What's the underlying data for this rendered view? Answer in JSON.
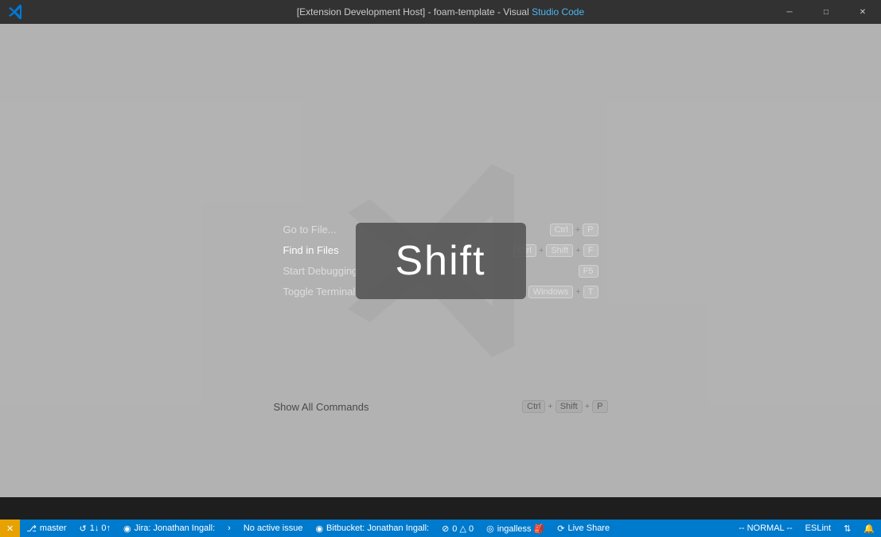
{
  "titleBar": {
    "title": "[Extension Development Host] - foam-template - Visual ",
    "titleBlue": "Studio Code",
    "minimize": "─",
    "maximize": "□",
    "close": "✕"
  },
  "mainArea": {
    "background": "#f3f3f3"
  },
  "shortcuts": [
    {
      "label": "Show All Commands",
      "keys": [
        "Ctrl",
        "+",
        "Shift",
        "+",
        "P"
      ]
    },
    {
      "label": "Go to File...",
      "keys": [
        "Ctrl",
        "+",
        "P"
      ]
    },
    {
      "label": "Find in Files",
      "keys": [
        "Ctrl",
        "+",
        "Shift",
        "+",
        "F"
      ]
    },
    {
      "label": "Start Debugging",
      "keys": [
        "F5"
      ]
    },
    {
      "label": "Toggle Terminal",
      "keys": [
        "Windows",
        "+",
        "T"
      ]
    }
  ],
  "shiftKey": "Shift",
  "statusBar": {
    "items": [
      {
        "id": "orange-icon",
        "icon": "✕",
        "text": "",
        "orange": true
      },
      {
        "id": "branch",
        "icon": "⎇",
        "text": "master"
      },
      {
        "id": "sync",
        "icon": "↺",
        "text": "1↓ 0↑"
      },
      {
        "id": "jira",
        "icon": "◉",
        "text": "Jira: Jonathan Ingall:"
      },
      {
        "id": "arrow",
        "icon": "›",
        "text": ""
      },
      {
        "id": "no-issue",
        "icon": "",
        "text": "No active issue"
      },
      {
        "id": "bitbucket",
        "icon": "◉",
        "text": "Bitbucket: Jonathan Ingall:"
      },
      {
        "id": "errors",
        "icon": "⊘",
        "text": "0 △ 0"
      },
      {
        "id": "user",
        "icon": "◎",
        "text": "ingalless 🎒"
      },
      {
        "id": "liveshare",
        "icon": "⟳",
        "text": "Live Share"
      },
      {
        "id": "normal",
        "icon": "",
        "text": "-- NORMAL --"
      },
      {
        "id": "eslint",
        "icon": "",
        "text": "ESLint"
      },
      {
        "id": "notification",
        "icon": "🔔",
        "text": ""
      }
    ]
  }
}
